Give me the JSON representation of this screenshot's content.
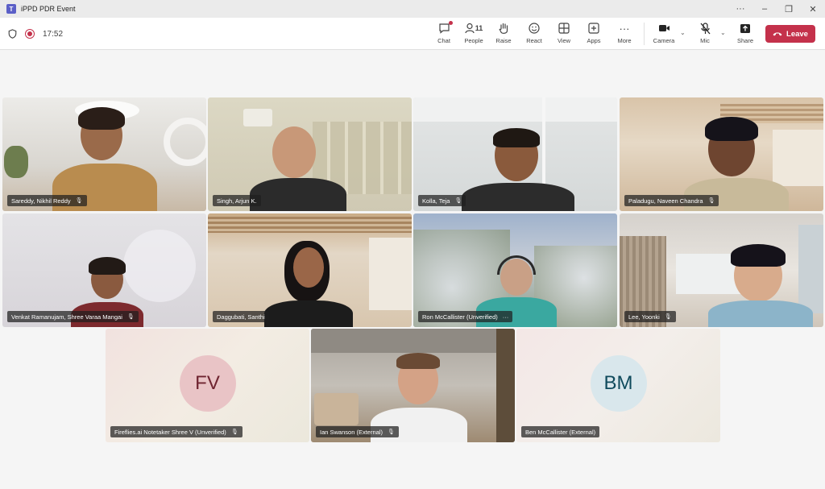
{
  "window": {
    "title": "iPPD PDR Event",
    "controls": [
      "···",
      "–",
      "❐",
      "✕"
    ]
  },
  "toolbar": {
    "timer": "17:52",
    "people_count": "11",
    "items": [
      {
        "label": "Chat",
        "icon": "chat-icon",
        "glyph": "💬"
      },
      {
        "label": "People",
        "icon": "people-icon",
        "glyph": "👤"
      },
      {
        "label": "Raise",
        "icon": "raise-hand-icon",
        "glyph": "✋"
      },
      {
        "label": "React",
        "icon": "react-icon",
        "glyph": "☺"
      },
      {
        "label": "View",
        "icon": "view-icon",
        "glyph": "⊞"
      },
      {
        "label": "Apps",
        "icon": "apps-icon",
        "glyph": "⊕"
      },
      {
        "label": "More",
        "icon": "more-icon",
        "glyph": "···"
      },
      {
        "label": "Camera",
        "icon": "camera-icon",
        "glyph": "■"
      },
      {
        "label": "Mic",
        "icon": "mic-off-icon",
        "glyph": "🎙"
      },
      {
        "label": "Share",
        "icon": "share-icon",
        "glyph": "⬆"
      }
    ],
    "leave_label": "Leave"
  },
  "participants": [
    {
      "name": "Sareddy, Nikhil Reddy",
      "muted": true
    },
    {
      "name": "Singh, Arjun K.",
      "muted": false
    },
    {
      "name": "Kolla, Teja",
      "muted": true
    },
    {
      "name": "Paladugu, Naveen Chandra",
      "muted": true
    },
    {
      "name": "Venkat Ramanujam, Shree Varaa Mangai",
      "muted": true
    },
    {
      "name": "Daggubati, Santhi",
      "muted": false
    },
    {
      "name": "Ron McCallister (Unverified)",
      "muted": false,
      "more": "···"
    },
    {
      "name": "Lee, Yoonki",
      "muted": true
    },
    {
      "name": "Fireflies.ai Notetaker Shree V (Unverified)",
      "muted": true,
      "initials": "FV"
    },
    {
      "name": "Ian Swanson (External)",
      "muted": true
    },
    {
      "name": "Ben McCallister (External)",
      "muted": false,
      "initials": "BM"
    }
  ],
  "colors": {
    "accent": "#5b5fc7",
    "leave": "#c4314b",
    "recording": "#c4314b"
  }
}
